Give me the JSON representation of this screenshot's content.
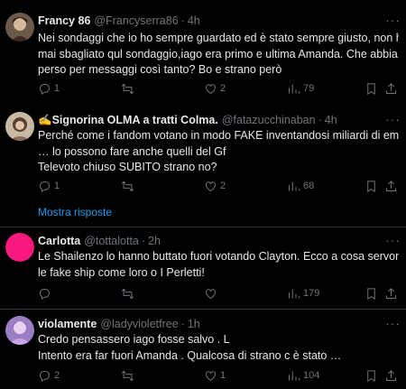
{
  "tweets": [
    {
      "name": "Francy 86",
      "handle": "@Francyserra86",
      "time": "4h",
      "lines": [
        "Nei sondaggi che io ho sempre guardato ed è stato sempre giusto, non ha",
        "mai sbagliato qul sondaggio,iago era primo e ultima Amanda. Che abbia",
        "perso per messaggi così tanto? Bo e strano però"
      ],
      "replies": "1",
      "retweets": "",
      "likes": "2",
      "views": "79"
    },
    {
      "name": "✍️Signorina OLMA a tratti Colma.",
      "handle": "@fatazucchinaban",
      "time": "4h",
      "lines": [
        "Perché come i fandom votano in modo FAKE inventandosi miliardi di email",
        "… lo possono fare anche quelli del Gf",
        "Televoto chiuso SUBITO strano no?"
      ],
      "replies": "1",
      "retweets": "",
      "likes": "2",
      "views": "68"
    },
    {
      "name": "Carlotta",
      "handle": "@tottalotta",
      "time": "2h",
      "lines": [
        "Le Shailenzo lo hanno buttato fuori votando Clayton. Ecco a cosa servono",
        "le fake ship come loro o I Perletti!"
      ],
      "replies": "",
      "retweets": "",
      "likes": "",
      "views": "179"
    },
    {
      "name": "violamente",
      "handle": "@ladyvioletfree",
      "time": "1h",
      "lines": [
        "Credo pensassero iago fosse salvo . L",
        "Intento era far fuori Amanda . Qualcosa di strano c è stato …"
      ],
      "replies": "2",
      "retweets": "",
      "likes": "1",
      "views": "104"
    }
  ],
  "show_replies_label": "Mostra risposte",
  "separator": "·",
  "more_icon": "more-icon",
  "colors": {
    "background": "#000000",
    "text": "#e7e9ea",
    "muted": "#71767b",
    "link": "#1d9bf0",
    "divider": "#2f3336",
    "carlotta_avatar": "#f91880"
  }
}
